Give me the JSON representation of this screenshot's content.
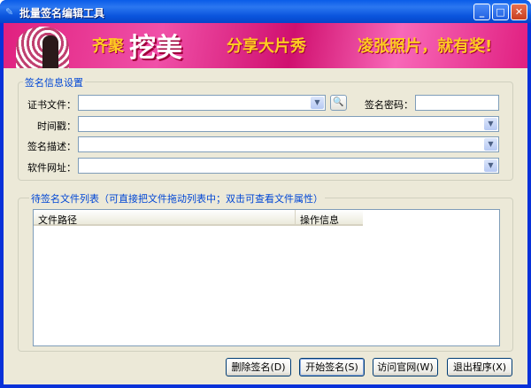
{
  "window": {
    "title": "批量签名编辑工具"
  },
  "banner": {
    "text1": "齐聚",
    "text2": "挖美",
    "text3": "分享大片秀",
    "text4": "凌张照片，就有奖!"
  },
  "settings": {
    "group_label": "签名信息设置",
    "cert_label": "证书文件：",
    "cert_value": "",
    "password_label": "签名密码：",
    "password_value": "",
    "timestamp_label": "时间戳：",
    "timestamp_value": "",
    "desc_label": "签名描述：",
    "desc_value": "",
    "url_label": "软件网址：",
    "url_value": ""
  },
  "files": {
    "group_label": "待签名文件列表（可直接把文件拖动列表中；双击可查看文件属性）",
    "columns": [
      "文件路径",
      "操作信息"
    ],
    "rows": []
  },
  "buttons": {
    "delete": "删除签名(D)",
    "start": "开始签名(S)",
    "visit": "访问官网(W)",
    "exit": "退出程序(X)"
  }
}
